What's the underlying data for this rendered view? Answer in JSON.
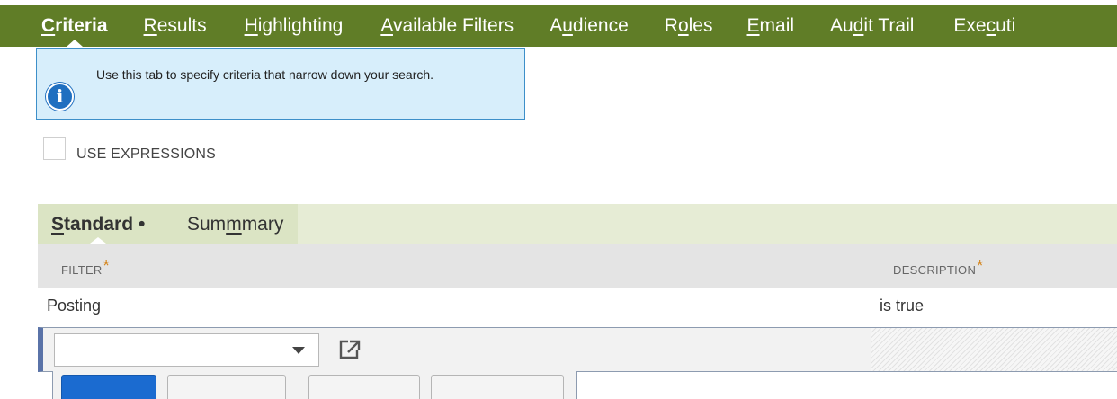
{
  "top_tabs": [
    {
      "label": "Criteria",
      "accel": "C",
      "rest": "riteria",
      "active": true
    },
    {
      "label": "Results",
      "accel": "R",
      "rest": "esults"
    },
    {
      "label": "Highlighting",
      "accel": "H",
      "rest": "ighlighting"
    },
    {
      "label": "Available Filters",
      "accel": "A",
      "rest": "vailable Filters"
    },
    {
      "label": "Audience",
      "pre": "A",
      "accel": "u",
      "rest": "dience"
    },
    {
      "label": "Roles",
      "pre": "R",
      "accel": "o",
      "rest": "les"
    },
    {
      "label": "Email",
      "accel": "E",
      "rest": "mail"
    },
    {
      "label": "Audit Trail",
      "pre": "Au",
      "accel": "d",
      "rest": "it Trail"
    },
    {
      "label": "Executi",
      "pre": "Exe",
      "accel": "c",
      "rest": "uti"
    }
  ],
  "info": {
    "text": "Use this tab to specify criteria that narrow down your search.",
    "icon": "info-icon",
    "color": "#1f6fc0"
  },
  "use_expressions": {
    "label": "USE EXPRESSIONS",
    "checked": false
  },
  "subtabs": [
    {
      "label": "Standard",
      "accel": "S",
      "rest": "tandard",
      "active": true,
      "dot": "•"
    },
    {
      "label": "Summary",
      "pre": "Sum",
      "accel": "m",
      "rest": "mary"
    }
  ],
  "criteria_table": {
    "headers": {
      "filter": "FILTER",
      "description": "DESCRIPTION",
      "required_mark": "*"
    },
    "rows": [
      {
        "filter": "Posting",
        "description": "is true"
      }
    ],
    "edit_row": {
      "filter_value": "",
      "dropdown_icon": "chevron-down-icon",
      "open_icon": "open-in-new-icon"
    }
  },
  "colors": {
    "tab_bar": "#607d27",
    "subtab_bar": "#e6ecd5",
    "info_bg": "#d7eefb",
    "required": "#d4841a",
    "primary_button": "#1b6bd0"
  }
}
